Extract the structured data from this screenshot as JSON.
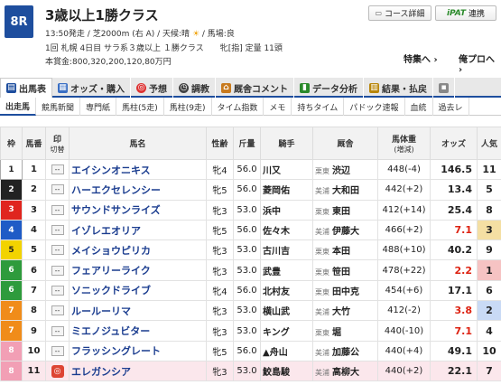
{
  "race": {
    "number": "8R",
    "title": "3歳以上1勝クラス",
    "info_line1_prefix": "13:50発走 / 芝2000m (右 A) / 天候:晴",
    "weather_icon": "sun-icon",
    "info_line1_suffix": "/ 馬場:良",
    "info_line2": "1回 札幌 4日目 サラ系３歳以上 １勝クラス　　牝[指] 定量 11頭",
    "info_line3": "本賞金:800,320,200,120,80万円"
  },
  "header": {
    "course_btn": "コース詳細",
    "ipat_logo": "iPAT",
    "ipat_btn": "連携",
    "feature_link": "特集へ",
    "prev_link": "俺プロへ"
  },
  "tabs": [
    "出馬表",
    "オッズ・購入",
    "予想",
    "調教",
    "厩舎コメント",
    "データ分析",
    "結果・払戻",
    ""
  ],
  "subtabs": [
    "出走馬",
    "競馬新聞",
    "専門紙",
    "馬柱(5走)",
    "馬柱(9走)",
    "タイム指数",
    "メモ",
    "持ちタイム",
    "パドック速報",
    "血統",
    "過去レ"
  ],
  "table_headers": {
    "waku": "枠",
    "umaban": "馬番",
    "mark": "印",
    "mark_sub": "切替",
    "horse": "馬名",
    "sexage": "性齢",
    "weight": "斤量",
    "jockey": "騎手",
    "trainer": "厩舎",
    "body_weight": "馬体重",
    "body_weight_sub": "(増減)",
    "odds": "オッズ",
    "ninki": "人気"
  },
  "colors": {
    "waku1": "#ffffff",
    "waku2": "#222222",
    "waku3": "#e0251e",
    "waku4": "#1f5bc6",
    "waku5": "#f2d300",
    "waku6": "#2e9b3c",
    "waku7": "#f08c1a",
    "waku8": "#f29fb5"
  },
  "rows": [
    {
      "waku": "1",
      "umaban": "1",
      "mark": "--",
      "horse": "エイシンオニキス",
      "sexage": "牝4",
      "weight": "56.0",
      "jockey": "川又",
      "area": "栗東",
      "trainer": "渋辺",
      "body": "448(-4)",
      "odds": "146.5",
      "ninki": "11"
    },
    {
      "waku": "2",
      "umaban": "2",
      "mark": "--",
      "horse": "ハーエクセレンシー",
      "sexage": "牝5",
      "weight": "56.0",
      "jockey": "菱岡佑",
      "area": "美浦",
      "trainer": "大和田",
      "body": "442(+2)",
      "odds": "13.4",
      "ninki": "5"
    },
    {
      "waku": "3",
      "umaban": "3",
      "mark": "--",
      "horse": "サウンドサンライズ",
      "sexage": "牝3",
      "weight": "53.0",
      "jockey": "浜中",
      "area": "栗東",
      "trainer": "東田",
      "body": "412(+14)",
      "odds": "25.4",
      "ninki": "8"
    },
    {
      "waku": "4",
      "umaban": "4",
      "mark": "--",
      "horse": "イゾレエオリア",
      "sexage": "牝5",
      "weight": "56.0",
      "jockey": "佐々木",
      "area": "美浦",
      "trainer": "伊藤大",
      "body": "466(+2)",
      "odds": "7.1",
      "ninki": "3"
    },
    {
      "waku": "5",
      "umaban": "5",
      "mark": "--",
      "horse": "メイショウピリカ",
      "sexage": "牝3",
      "weight": "53.0",
      "jockey": "古川吉",
      "area": "栗東",
      "trainer": "本田",
      "body": "488(+10)",
      "odds": "40.2",
      "ninki": "9"
    },
    {
      "waku": "6",
      "umaban": "6",
      "mark": "--",
      "horse": "フェアリーライク",
      "sexage": "牝3",
      "weight": "53.0",
      "jockey": "武豊",
      "area": "栗東",
      "trainer": "笹田",
      "body": "478(+22)",
      "odds": "2.2",
      "ninki": "1"
    },
    {
      "waku": "6",
      "umaban": "7",
      "mark": "--",
      "horse": "ソニックドライブ",
      "sexage": "牝4",
      "weight": "56.0",
      "jockey": "北村友",
      "area": "栗東",
      "trainer": "田中克",
      "body": "454(+6)",
      "odds": "17.1",
      "ninki": "6"
    },
    {
      "waku": "7",
      "umaban": "8",
      "mark": "--",
      "horse": "ルールーリマ",
      "sexage": "牝3",
      "weight": "53.0",
      "jockey": "横山武",
      "area": "美浦",
      "trainer": "大竹",
      "body": "412(-2)",
      "odds": "3.8",
      "ninki": "2"
    },
    {
      "waku": "7",
      "umaban": "9",
      "mark": "--",
      "horse": "ミエノジュビター",
      "sexage": "牝3",
      "weight": "53.0",
      "jockey": "キング",
      "area": "栗東",
      "trainer": "堀",
      "body": "440(-10)",
      "odds": "7.1",
      "ninki": "4"
    },
    {
      "waku": "8",
      "umaban": "10",
      "mark": "--",
      "horse": "フラッシングレート",
      "sexage": "牝5",
      "weight": "56.0",
      "jockey": "▲舟山",
      "area": "美浦",
      "trainer": "加藤公",
      "body": "440(+4)",
      "odds": "49.1",
      "ninki": "10"
    },
    {
      "waku": "8",
      "umaban": "11",
      "mark": "◎",
      "horse": "エレガンシア",
      "sexage": "牝3",
      "weight": "53.0",
      "jockey": "鮫島駿",
      "area": "美浦",
      "trainer": "高柳大",
      "body": "440(+2)",
      "odds": "22.1",
      "ninki": "7"
    }
  ]
}
